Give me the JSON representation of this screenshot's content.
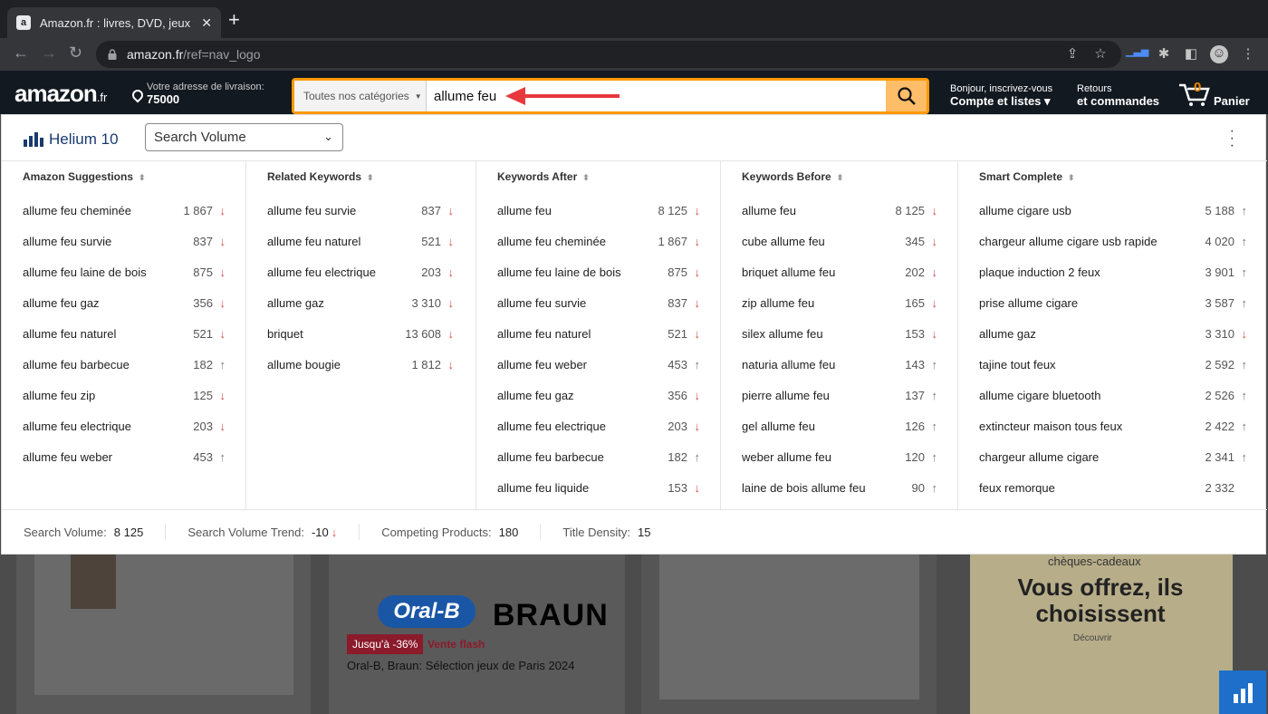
{
  "browser": {
    "tab_title": "Amazon.fr : livres, DVD, jeux vi",
    "url_host": "amazon.fr",
    "url_path": "/ref=nav_logo"
  },
  "amazon": {
    "logo": "amazon",
    "logo_suffix": ".fr",
    "address_line1": "Votre adresse de livraison:",
    "address_line2": "75000",
    "category": "Toutes nos catégories",
    "search_value": "allume feu",
    "account_line1": "Bonjour, inscrivez-vous",
    "account_line2": "Compte et listes",
    "returns_line1": "Retours",
    "returns_line2": "et commandes",
    "cart_count": "0",
    "cart_label": "Panier"
  },
  "helium": {
    "brand": "Helium 10",
    "metric_select": "Search Volume",
    "columns": [
      {
        "title": "Amazon Suggestions",
        "rows": [
          {
            "kw": "allume feu cheminée",
            "vol": "1 867",
            "trend": "↓",
            "dir": "down"
          },
          {
            "kw": "allume feu survie",
            "vol": "837",
            "trend": "↓",
            "dir": "down"
          },
          {
            "kw": "allume feu laine de bois",
            "vol": "875",
            "trend": "↓",
            "dir": "down"
          },
          {
            "kw": "allume feu gaz",
            "vol": "356",
            "trend": "↓",
            "dir": "down"
          },
          {
            "kw": "allume feu naturel",
            "vol": "521",
            "trend": "↓",
            "dir": "down"
          },
          {
            "kw": "allume feu barbecue",
            "vol": "182",
            "trend": "↑",
            "dir": "up"
          },
          {
            "kw": "allume feu zip",
            "vol": "125",
            "trend": "↓",
            "dir": "down"
          },
          {
            "kw": "allume feu electrique",
            "vol": "203",
            "trend": "↓",
            "dir": "down"
          },
          {
            "kw": "allume feu weber",
            "vol": "453",
            "trend": "↑",
            "dir": "up"
          }
        ]
      },
      {
        "title": "Related Keywords",
        "rows": [
          {
            "kw": "allume feu survie",
            "vol": "837",
            "trend": "↓",
            "dir": "down"
          },
          {
            "kw": "allume feu naturel",
            "vol": "521",
            "trend": "↓",
            "dir": "down"
          },
          {
            "kw": "allume feu electrique",
            "vol": "203",
            "trend": "↓",
            "dir": "down"
          },
          {
            "kw": "allume gaz",
            "vol": "3 310",
            "trend": "↓",
            "dir": "down"
          },
          {
            "kw": "briquet",
            "vol": "13 608",
            "trend": "↓",
            "dir": "down"
          },
          {
            "kw": "allume bougie",
            "vol": "1 812",
            "trend": "↓",
            "dir": "down"
          }
        ]
      },
      {
        "title": "Keywords After",
        "rows": [
          {
            "kw": "allume feu",
            "vol": "8 125",
            "trend": "↓",
            "dir": "down"
          },
          {
            "kw": "allume feu cheminée",
            "vol": "1 867",
            "trend": "↓",
            "dir": "down"
          },
          {
            "kw": "allume feu laine de bois",
            "vol": "875",
            "trend": "↓",
            "dir": "down"
          },
          {
            "kw": "allume feu survie",
            "vol": "837",
            "trend": "↓",
            "dir": "down"
          },
          {
            "kw": "allume feu naturel",
            "vol": "521",
            "trend": "↓",
            "dir": "down"
          },
          {
            "kw": "allume feu weber",
            "vol": "453",
            "trend": "↑",
            "dir": "up"
          },
          {
            "kw": "allume feu gaz",
            "vol": "356",
            "trend": "↓",
            "dir": "down"
          },
          {
            "kw": "allume feu electrique",
            "vol": "203",
            "trend": "↓",
            "dir": "down"
          },
          {
            "kw": "allume feu barbecue",
            "vol": "182",
            "trend": "↑",
            "dir": "up"
          },
          {
            "kw": "allume feu liquide",
            "vol": "153",
            "trend": "↓",
            "dir": "down"
          }
        ]
      },
      {
        "title": "Keywords Before",
        "rows": [
          {
            "kw": "allume feu",
            "vol": "8 125",
            "trend": "↓",
            "dir": "down"
          },
          {
            "kw": "cube allume feu",
            "vol": "345",
            "trend": "↓",
            "dir": "down"
          },
          {
            "kw": "briquet allume feu",
            "vol": "202",
            "trend": "↓",
            "dir": "down"
          },
          {
            "kw": "zip allume feu",
            "vol": "165",
            "trend": "↓",
            "dir": "down"
          },
          {
            "kw": "silex allume feu",
            "vol": "153",
            "trend": "↓",
            "dir": "down"
          },
          {
            "kw": "naturia allume feu",
            "vol": "143",
            "trend": "↑",
            "dir": "up"
          },
          {
            "kw": "pierre allume feu",
            "vol": "137",
            "trend": "↑",
            "dir": "up"
          },
          {
            "kw": "gel allume feu",
            "vol": "126",
            "trend": "↑",
            "dir": "up"
          },
          {
            "kw": "weber allume feu",
            "vol": "120",
            "trend": "↑",
            "dir": "up"
          },
          {
            "kw": "laine de bois allume feu",
            "vol": "90",
            "trend": "↑",
            "dir": "up"
          }
        ]
      },
      {
        "title": "Smart Complete",
        "rows": [
          {
            "kw": "allume cigare usb",
            "vol": "5 188",
            "trend": "↑",
            "dir": "up"
          },
          {
            "kw": "chargeur allume cigare usb rapide",
            "vol": "4 020",
            "trend": "↑",
            "dir": "up"
          },
          {
            "kw": "plaque induction 2 feux",
            "vol": "3 901",
            "trend": "↑",
            "dir": "up"
          },
          {
            "kw": "prise allume cigare",
            "vol": "3 587",
            "trend": "↑",
            "dir": "up"
          },
          {
            "kw": "allume gaz",
            "vol": "3 310",
            "trend": "↓",
            "dir": "down"
          },
          {
            "kw": "tajine tout feux",
            "vol": "2 592",
            "trend": "↑",
            "dir": "up"
          },
          {
            "kw": "allume cigare bluetooth",
            "vol": "2 526",
            "trend": "↑",
            "dir": "up"
          },
          {
            "kw": "extincteur maison tous feux",
            "vol": "2 422",
            "trend": "↑",
            "dir": "up"
          },
          {
            "kw": "chargeur allume cigare",
            "vol": "2 341",
            "trend": "↑",
            "dir": "up"
          },
          {
            "kw": "feux remorque",
            "vol": "2 332",
            "trend": "",
            "dir": "none"
          }
        ]
      }
    ],
    "footer": {
      "sv_label": "Search Volume:",
      "sv_value": "8 125",
      "trend_label": "Search Volume Trend:",
      "trend_value": "-10",
      "trend_arrow": "↓",
      "comp_label": "Competing Products:",
      "comp_value": "180",
      "density_label": "Title Density:",
      "density_value": "15"
    }
  },
  "background": {
    "deal_badge": "Jusqu'à -36%",
    "deal_flash": "Vente flash",
    "oral_b": "Oral-B",
    "braun": "BRAUN",
    "caption": "Oral-B, Braun: Sélection jeux de Paris 2024",
    "gift_top": "chèques-cadeaux",
    "gift_big": "Vous offrez, ils choisissent",
    "gift_small": "Découvrir"
  },
  "colors": {
    "amazon_nav": "#131921",
    "search_border": "#ff9900",
    "search_button": "#febd69",
    "trend_down": "#d14b4b",
    "trend_up": "#777777",
    "helium_blue": "#1a3a6e"
  }
}
